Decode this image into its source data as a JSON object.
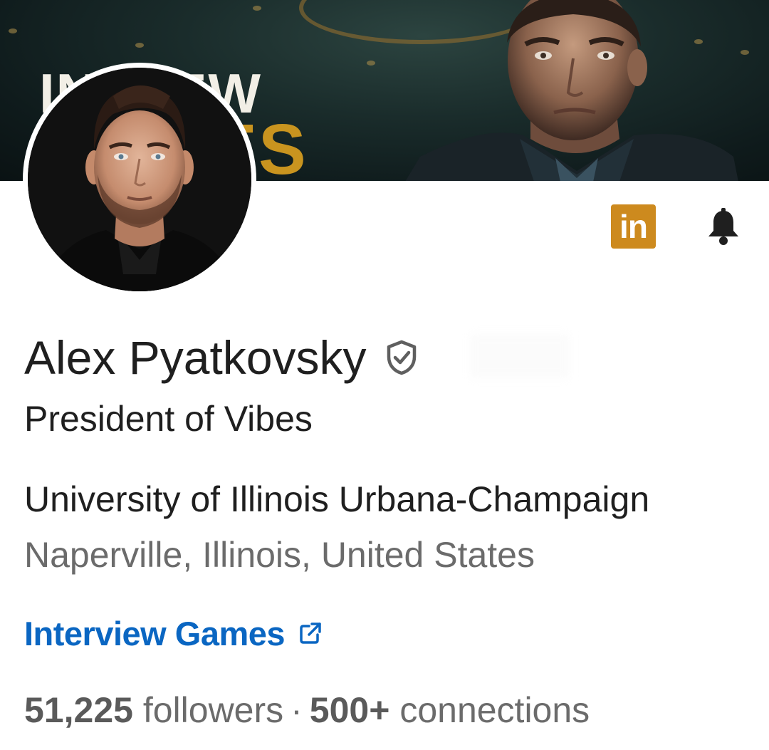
{
  "banner": {
    "line1": "IN  VIEW",
    "line2": "GAMES"
  },
  "profile": {
    "name": "Alex Pyatkovsky",
    "headline": "President of Vibes",
    "school": "University of Illinois Urbana-Champaign",
    "location": "Naperville, Illinois, United States",
    "website_label": "Interview Games",
    "followers_count": "51,225",
    "followers_label": "followers",
    "separator": "·",
    "connections_count": "500+",
    "connections_label": "connections"
  },
  "badges": {
    "linkedin_text": "in"
  },
  "colors": {
    "accent_link": "#0a66c2",
    "linkedin_badge": "#cd8a1e",
    "banner_gold": "#c9941f"
  },
  "icons": {
    "verified": "shield-check-icon",
    "notifications": "bell-icon",
    "external_link": "external-link-icon"
  }
}
